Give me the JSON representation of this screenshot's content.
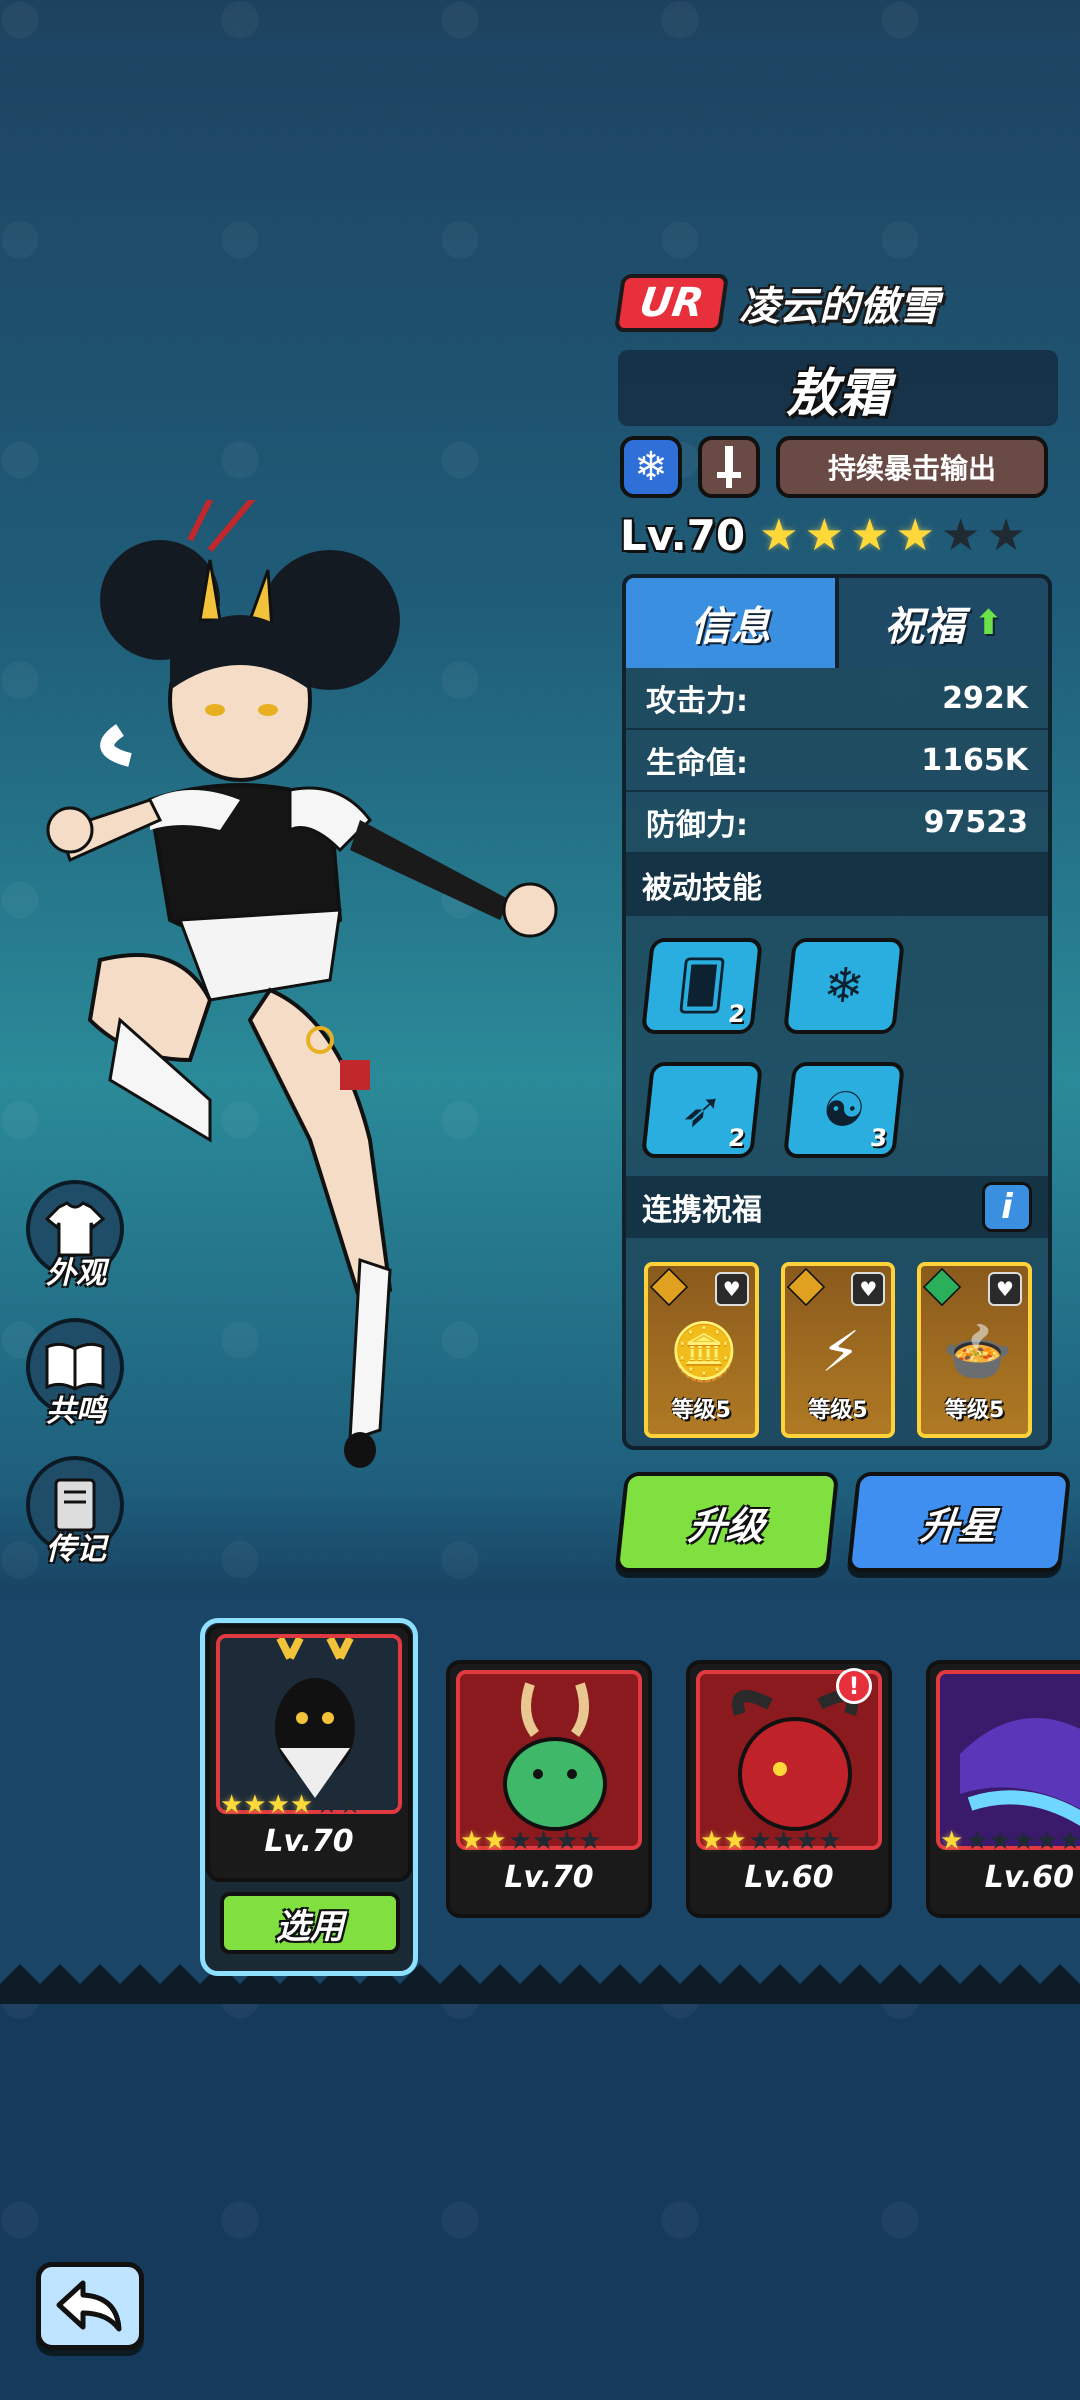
{
  "hero": {
    "rarity": "UR",
    "title": "凌云的傲雪",
    "name": "敖霜",
    "element_icon": "snowflake-icon",
    "weapon_icon": "sword-icon",
    "role": "持续暴击输出",
    "level": "Lv.70",
    "stars_filled": 4,
    "stars_total": 6
  },
  "tabs": {
    "info": "信息",
    "blessing": "祝福"
  },
  "stats": [
    {
      "label": "攻击力:",
      "value": "292K"
    },
    {
      "label": "生命值:",
      "value": "1165K"
    },
    {
      "label": "防御力:",
      "value": "97523"
    }
  ],
  "passive": {
    "title": "被动技能",
    "skills": [
      {
        "icon": "cards-icon",
        "count": "2"
      },
      {
        "icon": "snowflake-icon",
        "count": ""
      },
      {
        "icon": "claw-icon",
        "count": "2"
      },
      {
        "icon": "dragon-head-icon",
        "count": "3"
      }
    ]
  },
  "synergy": {
    "title": "连携祝福",
    "info": "i",
    "items": [
      {
        "icon": "gold-bars-icon",
        "label": "等级5"
      },
      {
        "icon": "lightning-orb-icon",
        "label": "等级5"
      },
      {
        "icon": "food-plate-icon",
        "label": "等级5"
      }
    ]
  },
  "actions": {
    "upgrade": "升级",
    "star_up": "升星"
  },
  "side_menu": [
    {
      "label": "外观",
      "icon": "shirt-icon"
    },
    {
      "label": "共鸣",
      "icon": "book-icon"
    },
    {
      "label": "传记",
      "icon": "journal-icon"
    }
  ],
  "roster": [
    {
      "level": "Lv.70",
      "stars": 4,
      "selected": true,
      "select_label": "选用",
      "art": "white-deer-icon"
    },
    {
      "level": "Lv.70",
      "stars": 2,
      "selected": false,
      "art": "green-dragon-icon"
    },
    {
      "level": "Lv.60",
      "stars": 2,
      "selected": false,
      "art": "red-demon-icon",
      "alert": "!"
    },
    {
      "level": "Lv.60",
      "stars": 1,
      "selected": false,
      "art": "purple-dragon-icon"
    }
  ],
  "colors": {
    "rarity_red": "#e8303c",
    "tab_active": "#3b8fe0",
    "upgrade_green": "#7fe040",
    "starup_blue": "#3e8ff0",
    "star_gold": "#ffd83a"
  }
}
